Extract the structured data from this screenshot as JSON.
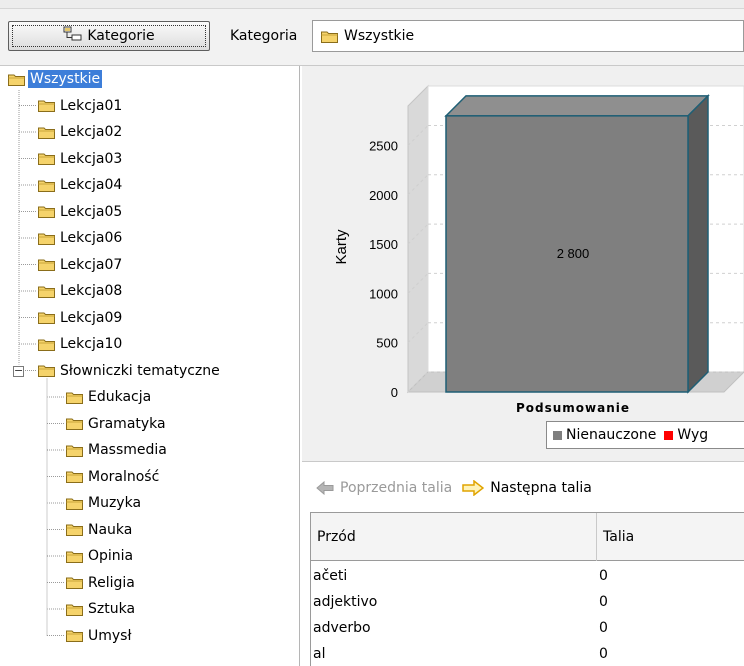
{
  "toolbar": {
    "category_button_label": "Kategorie",
    "category_label": "Kategoria",
    "category_value": "Wszystkie"
  },
  "tree": {
    "root": "Wszystkie",
    "lessons": [
      "Lekcja01",
      "Lekcja02",
      "Lekcja03",
      "Lekcja04",
      "Lekcja05",
      "Lekcja06",
      "Lekcja07",
      "Lekcja08",
      "Lekcja09",
      "Lekcja10"
    ],
    "group": "Słowniczki tematyczne",
    "topics": [
      "Edukacja",
      "Gramatyka",
      "Massmedia",
      "Moralność",
      "Muzyka",
      "Nauka",
      "Opinia",
      "Religia",
      "Sztuka",
      "Umysł"
    ]
  },
  "chart_data": {
    "type": "bar",
    "categories": [
      "Podsumowanie"
    ],
    "series": [
      {
        "name": "Nienauczone",
        "values": [
          2800
        ],
        "color": "#7f7f7f",
        "data_label": "2 800"
      },
      {
        "name": "Wyg",
        "values": [
          0
        ],
        "color": "#ff0000"
      }
    ],
    "ylabel": "Karty",
    "xlabel": "",
    "ylim": [
      0,
      2900
    ],
    "yticks": [
      "0",
      "500",
      "1000",
      "1500",
      "2000",
      "2500"
    ],
    "grid": true,
    "legend": "bottom"
  },
  "nav": {
    "prev_label": "Poprzednia talia",
    "next_label": "Następna talia"
  },
  "table": {
    "columns": [
      "Przód",
      "Talia"
    ],
    "rows": [
      {
        "front": "ačeti",
        "deck": "0"
      },
      {
        "front": "adjektivo",
        "deck": "0"
      },
      {
        "front": "adverbo",
        "deck": "0"
      },
      {
        "front": "al",
        "deck": "0"
      }
    ]
  },
  "colors": {
    "selection": "#3d7ed9",
    "bar": "#7f7f7f",
    "bar_edge": "#1f5f75",
    "next_arrow": "#f0b400",
    "prev_arrow": "#aaaaaa"
  }
}
